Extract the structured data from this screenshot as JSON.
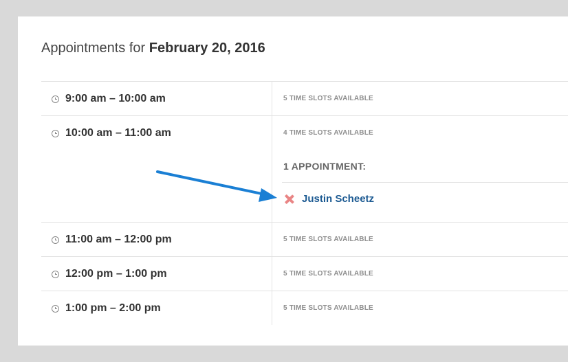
{
  "heading": {
    "prefix": "Appointments for",
    "date": "February 20, 2016"
  },
  "rows": [
    {
      "time": "9:00 am – 10:00 am",
      "slots": "5 TIME SLOTS AVAILABLE"
    },
    {
      "time": "10:00 am – 11:00 am",
      "slots": "4 TIME SLOTS AVAILABLE",
      "appointments_title": "1 APPOINTMENT:",
      "appointments": [
        {
          "name": "Justin Scheetz",
          "remove_icon": "x-icon"
        }
      ]
    },
    {
      "time": "11:00 am – 12:00 pm",
      "slots": "5 TIME SLOTS AVAILABLE"
    },
    {
      "time": "12:00 pm – 1:00 pm",
      "slots": "5 TIME SLOTS AVAILABLE"
    },
    {
      "time": "1:00 pm – 2:00 pm",
      "slots": "5 TIME SLOTS AVAILABLE"
    }
  ],
  "colors": {
    "link": "#1c5a92",
    "remove": "#e98585",
    "annotation_arrow": "#1a7fd4"
  }
}
